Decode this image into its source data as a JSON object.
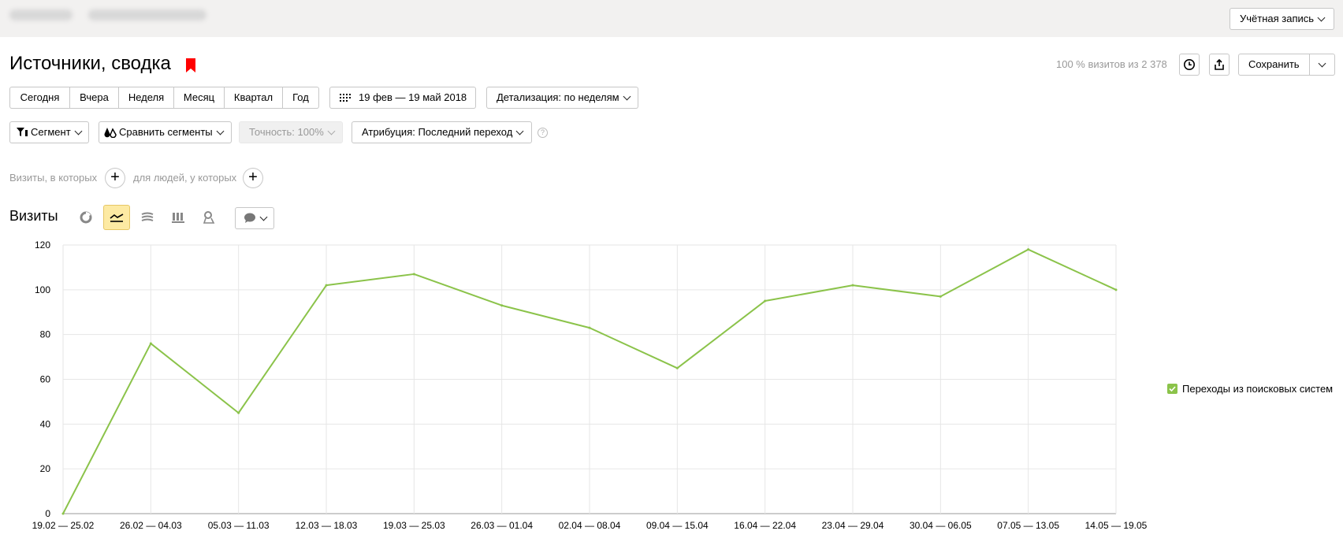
{
  "header": {
    "account_label": "Учётная запись"
  },
  "report": {
    "title": "Источники, сводка",
    "visits_info": "100 % визитов из 2 378",
    "save_label": "Сохранить"
  },
  "periods": [
    "Сегодня",
    "Вчера",
    "Неделя",
    "Месяц",
    "Квартал",
    "Год"
  ],
  "date_range": "19 фев — 19 май 2018",
  "detail_label": "Детализация: по неделям",
  "filters": {
    "segment": "Сегмент",
    "compare": "Сравнить сегменты",
    "accuracy": "Точность: 100%",
    "attribution": "Атрибуция: Последний переход"
  },
  "conditions": {
    "visits_where": "Визиты, в которых",
    "people_where": "для людей, у которых"
  },
  "chart_section": {
    "label": "Визиты"
  },
  "icons": {
    "segment": "filter-icon",
    "compare": "compare-segments-icon",
    "help": "help-icon",
    "history": "clock-icon",
    "export": "export-icon",
    "pie": "pie-chart-icon",
    "line": "line-chart-icon",
    "area": "area-chart-icon",
    "bar": "bar-chart-icon",
    "map": "map-icon",
    "notes": "comment-icon"
  },
  "colors": {
    "series": "#8bc34a",
    "active_tool": "#fdeaa3",
    "bookmark": "#ff0000"
  },
  "chart_data": {
    "type": "line",
    "title": "",
    "xlabel": "",
    "ylabel": "",
    "ylim": [
      0,
      120
    ],
    "yticks": [
      0,
      20,
      40,
      60,
      80,
      100,
      120
    ],
    "categories": [
      "19.02 — 25.02",
      "26.02 — 04.03",
      "05.03 — 11.03",
      "12.03 — 18.03",
      "19.03 — 25.03",
      "26.03 — 01.04",
      "02.04 — 08.04",
      "09.04 — 15.04",
      "16.04 — 22.04",
      "23.04 — 29.04",
      "30.04 — 06.05",
      "07.05 — 13.05",
      "14.05 — 19.05"
    ],
    "series": [
      {
        "name": "Переходы из поисковых систем",
        "values": [
          0,
          76,
          45,
          102,
          107,
          93,
          83,
          65,
          95,
          102,
          97,
          118,
          100
        ]
      }
    ],
    "grid": true,
    "legend": "right"
  }
}
